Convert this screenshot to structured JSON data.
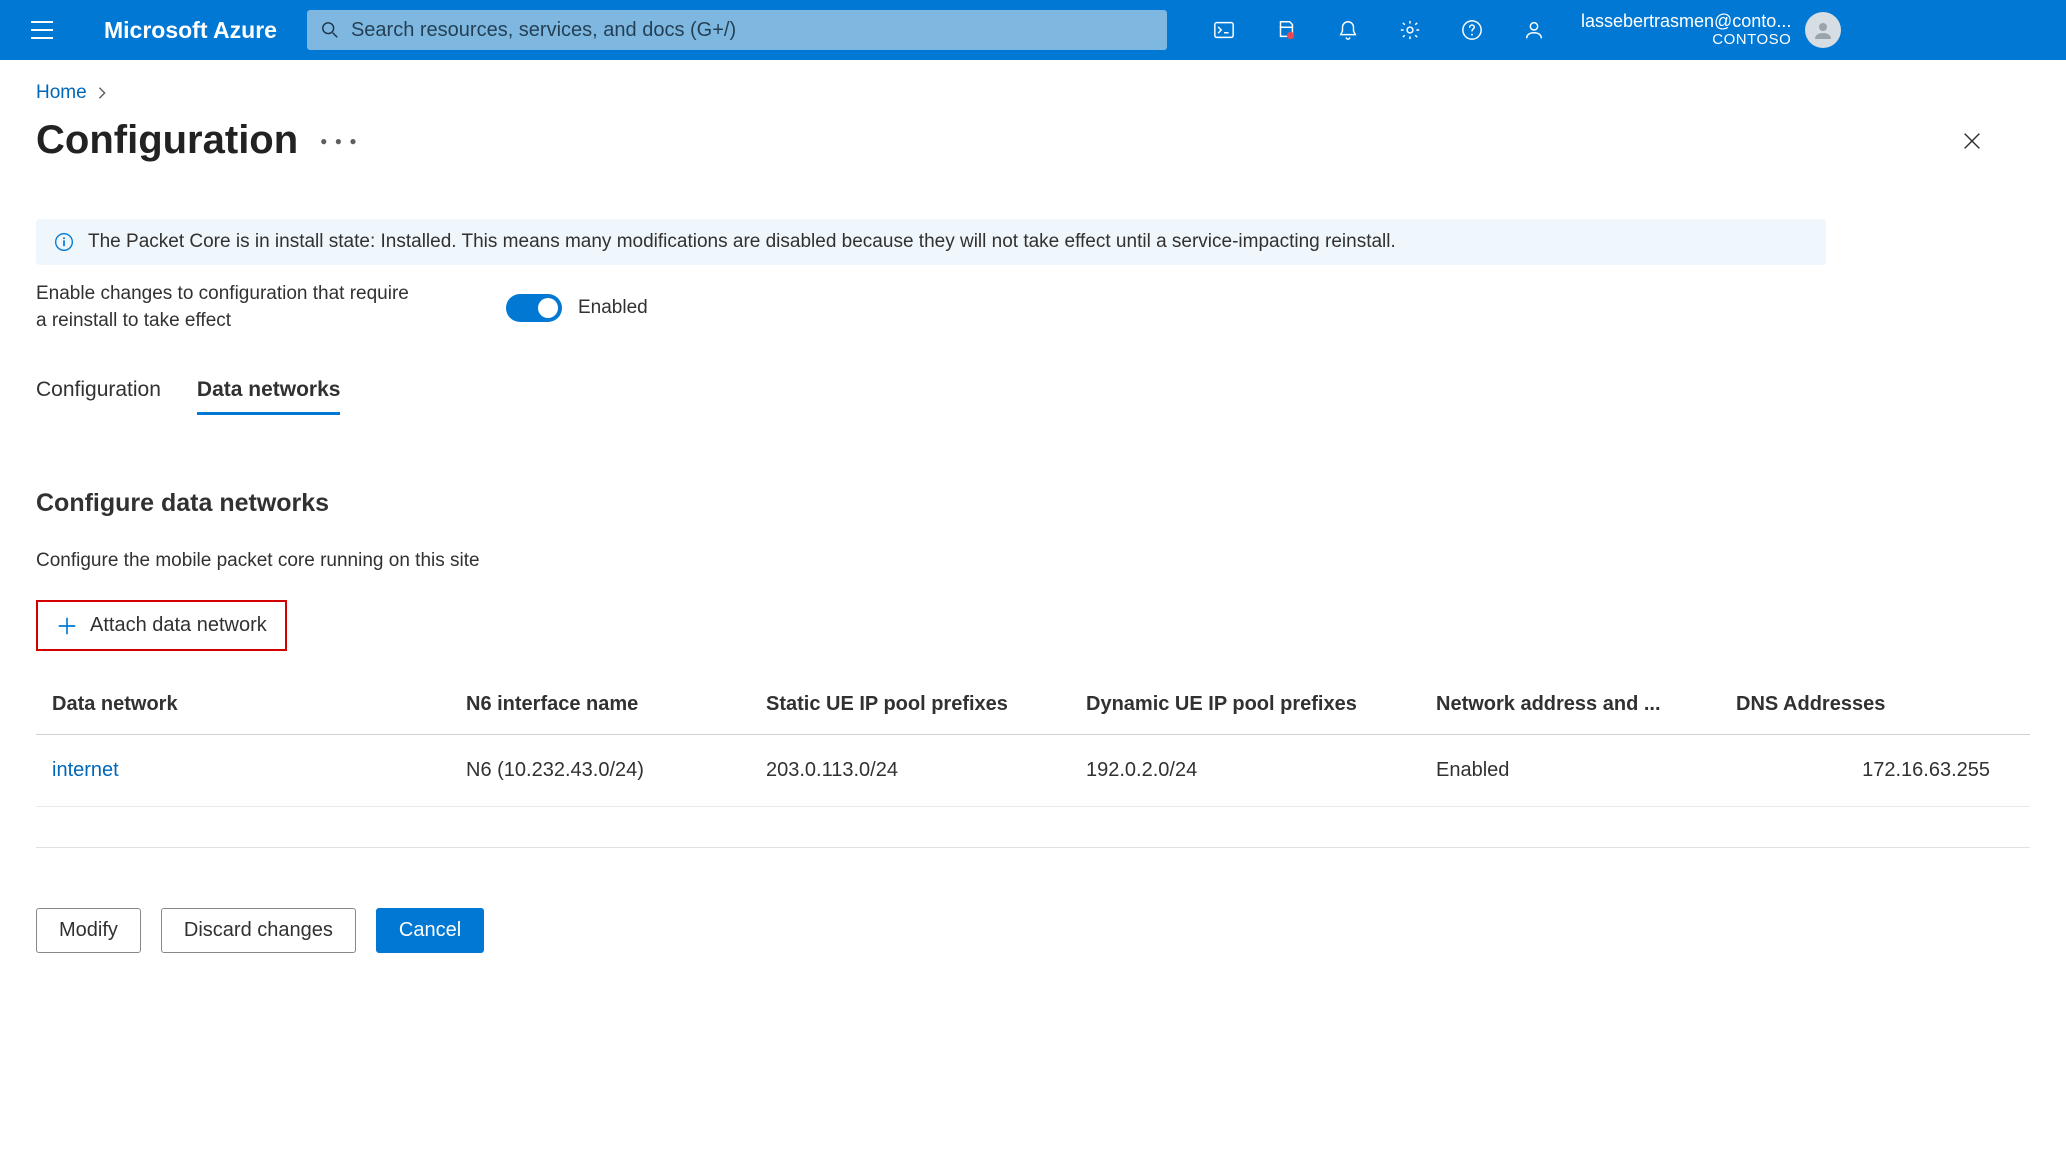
{
  "topbar": {
    "brand": "Microsoft Azure",
    "search_placeholder": "Search resources, services, and docs (G+/)",
    "account_email": "lassebertrasmen@conto...",
    "account_tenant": "CONTOSO"
  },
  "breadcrumb": {
    "items": [
      "Home"
    ]
  },
  "page": {
    "title": "Configuration",
    "info_message": "The Packet Core is in install state: Installed. This means many modifications are disabled because they will not take effect until a service-impacting reinstall.",
    "enable_label": "Enable changes to configuration that require a reinstall to take effect",
    "toggle_state": "Enabled",
    "tabs": [
      {
        "label": "Configuration",
        "active": false
      },
      {
        "label": "Data networks",
        "active": true
      }
    ],
    "section_title": "Configure data networks",
    "section_desc": "Configure the mobile packet core running on this site",
    "attach_button": "Attach data network",
    "columns": [
      "Data network",
      "N6 interface name",
      "Static UE IP pool prefixes",
      "Dynamic UE IP pool prefixes",
      "Network address and ...",
      "DNS Addresses"
    ],
    "rows": [
      {
        "name": "internet",
        "n6": "N6 (10.232.43.0/24)",
        "static": "203.0.113.0/24",
        "dynamic": "192.0.2.0/24",
        "napt": "Enabled",
        "dns": "172.16.63.255"
      }
    ],
    "footer": {
      "modify": "Modify",
      "discard": "Discard changes",
      "cancel": "Cancel"
    }
  }
}
